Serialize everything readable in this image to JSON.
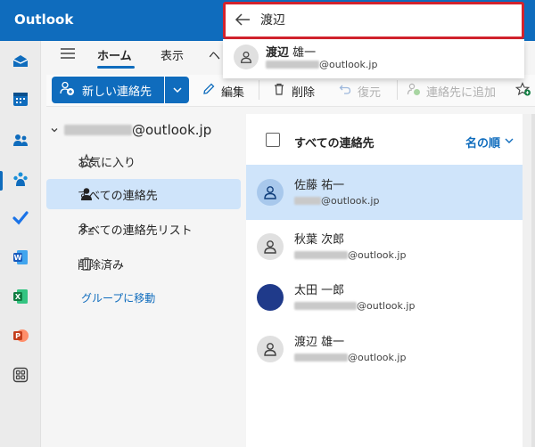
{
  "app": {
    "title": "Outlook"
  },
  "colors": {
    "brand": "#0f6cbd",
    "highlight": "#d3232d",
    "selected_bg": "#cfe4fa"
  },
  "search": {
    "value": "渡辺",
    "placeholder": ""
  },
  "suggestion": {
    "name_bold": "渡辺",
    "name_rest": " 雄一",
    "email_domain": "@outlook.jp"
  },
  "ribbon": {
    "tabs": [
      "ホーム",
      "表示",
      "ヘ"
    ],
    "new_contact": "新しい連絡先",
    "edit": "編集",
    "delete": "削除",
    "restore": "復元",
    "add_to_contacts": "連絡先に追加"
  },
  "folders": {
    "account_domain": "@outlook.jp",
    "items": [
      "お気に入り",
      "すべての連絡先",
      "すべての連絡先リスト",
      "削除済み"
    ],
    "goto_group": "グループに移動"
  },
  "list": {
    "header": "すべての連絡先",
    "sort": "名の順",
    "contacts": [
      {
        "name": "佐藤 祐一",
        "domain": "@outlook.jp"
      },
      {
        "name": "秋葉 次郎",
        "domain": "@outlook.jp"
      },
      {
        "name": "太田 一郎",
        "domain": "@outlook.jp"
      },
      {
        "name": "渡辺 雄一",
        "domain": "@outlook.jp"
      }
    ]
  },
  "icons": [
    "mail-icon",
    "calendar-icon",
    "people-icon",
    "teams-icon",
    "todo-icon",
    "word-icon",
    "excel-icon",
    "powerpoint-icon",
    "apps-icon",
    "hamburger-icon",
    "star-icon",
    "person-icon",
    "contact-list-icon",
    "trash-icon",
    "back-arrow-icon",
    "chevron-down-icon",
    "pencil-icon",
    "undo-icon",
    "add-person-icon"
  ]
}
